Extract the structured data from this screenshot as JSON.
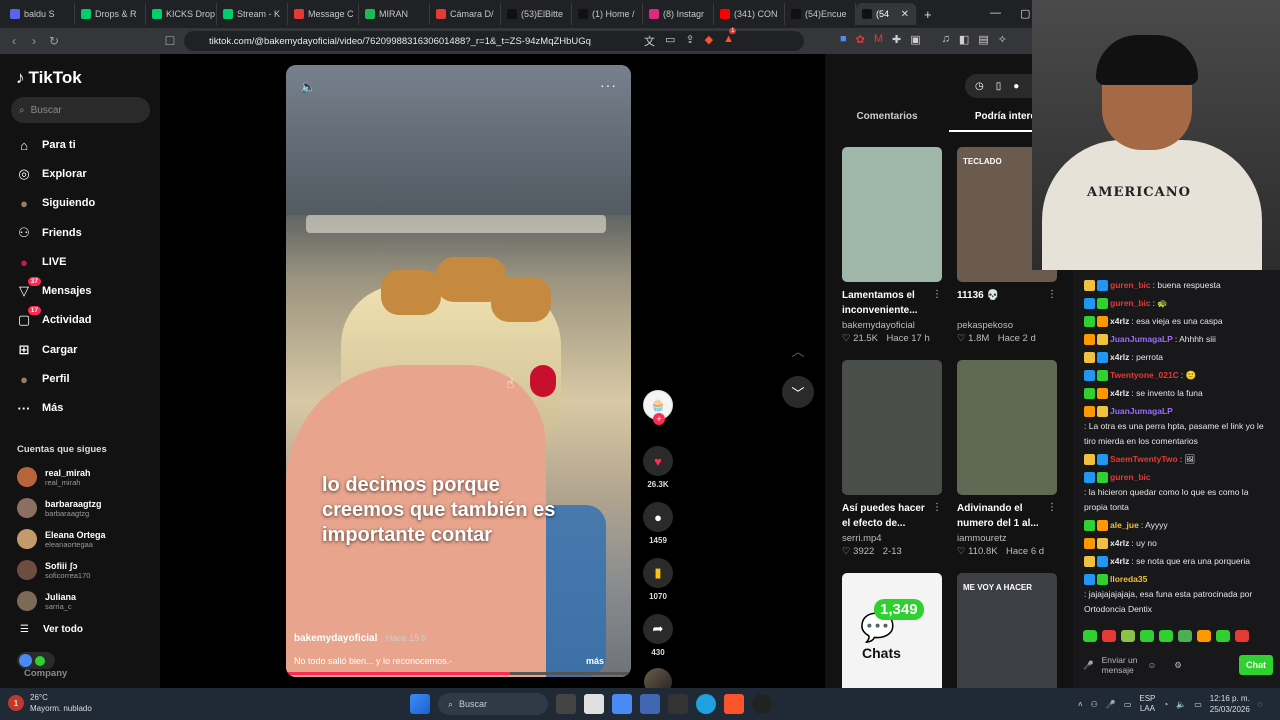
{
  "browser": {
    "tabs": [
      {
        "label": "baldu S",
        "color": "#5865f2"
      },
      {
        "label": "Drops & R",
        "color": "#00d06c"
      },
      {
        "label": "KICKS Drop",
        "color": "#00d06c"
      },
      {
        "label": "Stream - K",
        "color": "#00d06c"
      },
      {
        "label": "Message C",
        "color": "#e53935"
      },
      {
        "label": "MIRAN",
        "color": "#1db954"
      },
      {
        "label": "Cámara D/",
        "color": "#e53935"
      },
      {
        "label": "(53)ElBitte",
        "color": "#111111"
      },
      {
        "label": "(1) Home /",
        "color": "#111111"
      },
      {
        "label": "(8) Instagr",
        "color": "#dd2a7b"
      },
      {
        "label": "(341) CON",
        "color": "#ff0000"
      },
      {
        "label": "(54)Encue",
        "color": "#111111"
      },
      {
        "label": "(54",
        "color": "#111111",
        "active": true
      }
    ],
    "new_tab_icon": "+",
    "url": "tiktok.com/@bakemydayoficial/video/7620998831630601488?_r=1&_t=ZS-94zMqZHbUGq",
    "brave_badge": "1"
  },
  "sidebar": {
    "brand": "TikTok",
    "search_placeholder": "Buscar",
    "nav": [
      {
        "label": "Para ti",
        "icon": "home-icon",
        "glyph": "⌂"
      },
      {
        "label": "Explorar",
        "icon": "compass-icon",
        "glyph": "◎"
      },
      {
        "label": "Siguiendo",
        "icon": "avatar-icon",
        "glyph": "●"
      },
      {
        "label": "Friends",
        "icon": "friends-icon",
        "glyph": "⚇"
      },
      {
        "label": "LIVE",
        "icon": "live-icon",
        "glyph": "●"
      },
      {
        "label": "Mensajes",
        "icon": "messages-icon",
        "glyph": "▽",
        "badge": "37"
      },
      {
        "label": "Actividad",
        "icon": "activity-icon",
        "glyph": "▢",
        "badge": "17"
      },
      {
        "label": "Cargar",
        "icon": "upload-icon",
        "glyph": "⊞"
      },
      {
        "label": "Perfil",
        "icon": "profile-icon",
        "glyph": "●"
      },
      {
        "label": "Más",
        "icon": "more-icon",
        "glyph": "···"
      }
    ],
    "following_title": "Cuentas que sigues",
    "following": [
      {
        "name": "real_mirah",
        "handle": "real_mirah",
        "color": "#b5643c"
      },
      {
        "name": "barbaraagtzg",
        "handle": "barbaraagtzg",
        "color": "#8d6e63"
      },
      {
        "name": "Eleana Ortega",
        "handle": "eleanaortegaa",
        "color": "#c49a6c"
      },
      {
        "name": "Sofiii ʃɔ",
        "handle": "soficorrea170",
        "color": "#6d4c41"
      },
      {
        "name": "Juliana",
        "handle": "sarria_c",
        "color": "#7b6a58"
      }
    ],
    "see_all": "Ver todo",
    "company": "Company"
  },
  "video": {
    "caption_lines": [
      "lo decimos porque",
      "creemos que también es",
      "importante contar"
    ],
    "author": "bakemydayoficial",
    "time": "· Hace 15 h",
    "description": "No todo salió bien... y lo reconocemos.-",
    "more": "más",
    "progress": 0.65,
    "likes": "26.3K",
    "comments": "1459",
    "saves": "1070",
    "shares": "430"
  },
  "right_panel": {
    "tab_comments": "Comentarios",
    "tab_more": "Podría interesa",
    "cards": [
      {
        "title": "Lamentamos el inconveniente...",
        "author": "bakemydayoficial",
        "likes": "21.5K",
        "time": "Hace 17 h",
        "bg": "#9fb7a8"
      },
      {
        "title": "11136 💀",
        "author": "pekaspekoso",
        "likes": "1.8M",
        "time": "Hace 2 d",
        "bg": "#6b5a4e",
        "label": "TECLADO"
      },
      {
        "title": "Así puedes hacer el efecto de...",
        "author": "serri.mp4",
        "likes": "3922",
        "time": "2-13",
        "bg": "#4a4e4a"
      },
      {
        "title": "Adivinando el numero del 1 al...",
        "author": "iammouretz",
        "likes": "110.8K",
        "time": "Hace 6 d",
        "bg": "#5f6a55"
      },
      {
        "title": "",
        "author": "",
        "likes": "",
        "time": "",
        "bg": "#f4f4f4",
        "chats": "Chats",
        "chats_count": "1,349"
      },
      {
        "title": "",
        "author": "",
        "likes": "",
        "time": "",
        "bg": "#3e3e46",
        "label": "ME VOY A HACER"
      }
    ]
  },
  "webcam": {
    "hoodie_text": "AMERICANO"
  },
  "chat": {
    "messages": [
      {
        "user": "guren_bic",
        "color": "#e53935",
        "text": ": buena respuesta"
      },
      {
        "user": "guren_bic",
        "color": "#e53935",
        "text": ": 🐢"
      },
      {
        "user": "x4rlz",
        "color": "#e8e8e8",
        "text": ": esa vieja es una caspa"
      },
      {
        "user": "JuanJumagaLP",
        "color": "#9b6cff",
        "text": ": Ahhhh siii"
      },
      {
        "user": "x4rlz",
        "color": "#e8e8e8",
        "text": ": perrota"
      },
      {
        "user": "Twentyone_021C",
        "color": "#e53935",
        "text": ": 🙂"
      },
      {
        "user": "x4rlz",
        "color": "#e8e8e8",
        "text": ": se invento la funa"
      },
      {
        "user": "JuanJumagaLP",
        "color": "#9b6cff",
        "text": ": La otra es una perra hpta, pasame el link yo le tiro mierda en los comentarios"
      },
      {
        "user": "SaemTwentyTwo",
        "color": "#e53935",
        "text": ": 🖼"
      },
      {
        "user": "guren_bic",
        "color": "#e53935",
        "text": ": la hicieron quedar como lo que es como la propia tonta"
      },
      {
        "user": "ale_jue",
        "color": "#f0c040",
        "text": ": Ayyyy"
      },
      {
        "user": "x4rlz",
        "color": "#e8e8e8",
        "text": ": uy no"
      },
      {
        "user": "x4rlz",
        "color": "#e8e8e8",
        "text": ": se nota que era una porqueria"
      },
      {
        "user": "lloreda35",
        "color": "#f0c040",
        "text": ": jajajajajajaja, esa funa esta patrocinada por Ortodoncia Dentix"
      }
    ],
    "input_placeholder": "Enviar un mensaje",
    "send_button": "Chat"
  },
  "taskbar": {
    "weather_temp": "26°C",
    "weather_desc": "Mayorm. nublado",
    "search": "Buscar",
    "lang": "ESP",
    "lang2": "LAA",
    "time": "12:16 p. m.",
    "date": "25/03/2026"
  }
}
